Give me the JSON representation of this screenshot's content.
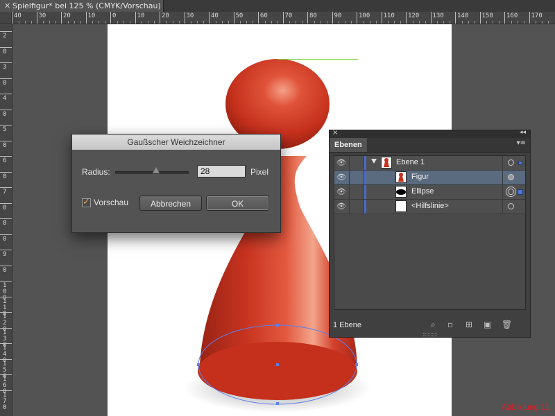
{
  "document_tab": {
    "title": "Spielfigur* bei 125 % (CMYK/Vorschau)",
    "close_glyph": "✕"
  },
  "ruler": {
    "h_labels": [
      "40",
      "30",
      "20",
      "10",
      "0",
      "10",
      "20",
      "30",
      "40",
      "50",
      "60",
      "70",
      "80",
      "90",
      "100",
      "110",
      "120",
      "130",
      "140",
      "150",
      "160",
      "170"
    ],
    "v_labels": [
      "2",
      "0",
      "3",
      "0",
      "4",
      "0",
      "5",
      "0",
      "6",
      "0",
      "7",
      "0",
      "8",
      "0",
      "9",
      "0",
      "1 0 0",
      "1 1 0",
      "1 2 0",
      "1 3 0",
      "1 4 0",
      "1 5 0",
      "1 6 0",
      "1 7 0"
    ]
  },
  "dialog": {
    "title": "Gaußscher Weichzeichner",
    "radius_label": "Radius:",
    "radius_value": "28",
    "radius_slider_fraction": 0.56,
    "unit": "Pixel",
    "preview_label": "Vorschau",
    "preview_checked": true,
    "check_glyph": "✓",
    "cancel_label": "Abbrechen",
    "ok_label": "OK"
  },
  "layers_panel": {
    "tab_label": "Ebenen",
    "close_glyph": "×",
    "collapse_glyph": "◂◂",
    "menu_glyph": "▾≡",
    "rows": [
      {
        "name": "Ebene 1",
        "thumb": "figure",
        "level": 0,
        "selected": false
      },
      {
        "name": "Figur",
        "thumb": "figure",
        "level": 1,
        "selected": true
      },
      {
        "name": "Ellipse",
        "thumb": "ellipse",
        "level": 1,
        "selected": false
      },
      {
        "name": "<Hilfslinie>",
        "thumb": "blank",
        "level": 1,
        "selected": false
      }
    ],
    "eye_glyph": "👁",
    "footer_label": "1 Ebene",
    "footer_icons": [
      "locate-icon",
      "clipping-mask-icon",
      "new-sublayer-icon",
      "new-layer-icon",
      "trash-icon"
    ],
    "footer_glyphs": [
      "⌕",
      "▫",
      "⊞",
      "▣",
      "🗑"
    ]
  },
  "caption": "Abbildung 11",
  "colors": {
    "figure_red": "#c8301d",
    "guide_green": "#7fd43b",
    "path_blue": "#5a7ff0",
    "caption_red": "#e31e24"
  }
}
